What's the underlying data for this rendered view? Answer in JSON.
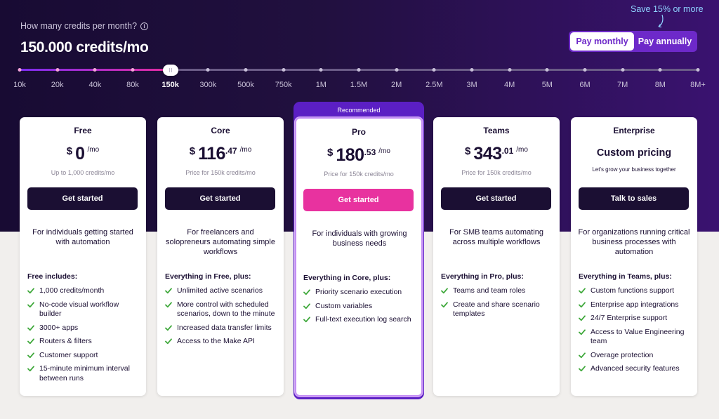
{
  "header": {
    "question": "How many credits per month?",
    "info_icon": "info-icon",
    "credits_title": "150.000 credits/mo",
    "save_note": "Save 15% or more"
  },
  "billing_toggle": {
    "monthly_label": "Pay monthly",
    "annual_label": "Pay annually",
    "selected": "monthly",
    "active_color": "#6d29c9"
  },
  "slider": {
    "ticks": [
      "10k",
      "20k",
      "40k",
      "80k",
      "150k",
      "300k",
      "500k",
      "750k",
      "1M",
      "1.5M",
      "2M",
      "2.5M",
      "3M",
      "4M",
      "5M",
      "6M",
      "7M",
      "8M",
      "8M+"
    ],
    "selected_index": 4
  },
  "recommended_label": "Recommended",
  "plans": [
    {
      "name": "Free",
      "currency": "$",
      "price_main": "0",
      "price_cents": "",
      "price_unit": "/mo",
      "price_note": "Up to 1,000 credits/mo",
      "cta": "Get started",
      "description": "For individuals getting started with automation",
      "features_heading": "Free includes:",
      "features": [
        "1,000 credits/month",
        "No-code visual workflow builder",
        "3000+ apps",
        "Routers & filters",
        "Customer support",
        "15-minute minimum interval between runs"
      ]
    },
    {
      "name": "Core",
      "currency": "$",
      "price_main": "116",
      "price_cents": ".47",
      "price_unit": "/mo",
      "price_note": "Price for 150k credits/mo",
      "cta": "Get started",
      "description": "For freelancers and solopreneurs automating simple workflows",
      "features_heading": "Everything in Free, plus:",
      "features": [
        "Unlimited active scenarios",
        "More control with scheduled scenarios, down to the minute",
        "Increased data transfer limits",
        "Access to the Make API"
      ]
    },
    {
      "name": "Pro",
      "currency": "$",
      "price_main": "180",
      "price_cents": ".53",
      "price_unit": "/mo",
      "price_note": "Price for 150k credits/mo",
      "cta": "Get started",
      "description": "For individuals with growing business needs",
      "features_heading": "Everything in Core, plus:",
      "features": [
        "Priority scenario execution",
        "Custom variables",
        "Full-text execution log search"
      ]
    },
    {
      "name": "Teams",
      "currency": "$",
      "price_main": "343",
      "price_cents": ".01",
      "price_unit": "/mo",
      "price_note": "Price for 150k credits/mo",
      "cta": "Get started",
      "description": "For SMB teams automating across multiple workflows",
      "features_heading": "Everything in Pro, plus:",
      "features": [
        "Teams and team roles",
        "Create and share scenario templates"
      ]
    },
    {
      "name": "Enterprise",
      "custom_price": "Custom pricing",
      "price_note": "Let's grow your business together",
      "cta": "Talk to sales",
      "description": "For organizations running critical business processes with automation",
      "features_heading": "Everything in Teams, plus:",
      "features": [
        "Custom functions support",
        "Enterprise app integrations",
        "24/7 Enterprise support",
        "Access to Value Engineering team",
        "Overage protection",
        "Advanced security features"
      ]
    }
  ],
  "colors": {
    "brand_purple": "#6d29c9",
    "pink_cta": "#e8329f",
    "dark_cta": "#1b0f33",
    "check_green": "#3ea83a",
    "save_note": "#8fd3ff"
  }
}
